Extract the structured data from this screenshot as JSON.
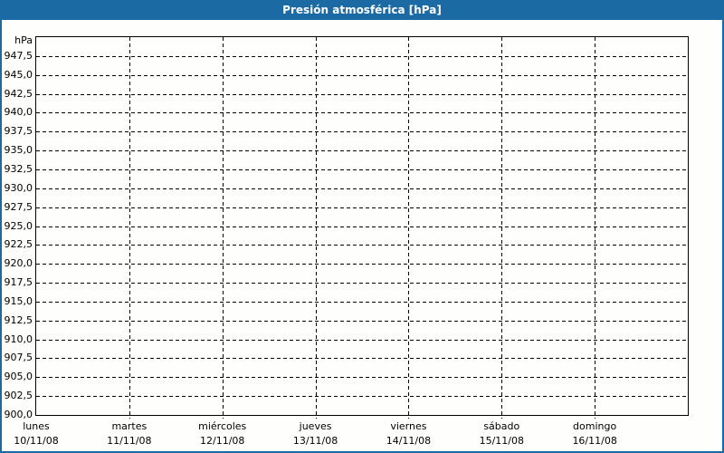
{
  "title_bar": {
    "title": "Presión atmosférica [hPa]"
  },
  "colors": {
    "title_bar_bg": "#1b6aa3",
    "frame_border": "#1b6aa3",
    "title_text": "#ffffff",
    "plot_bg": "#fefefc",
    "axis": "#000000",
    "grid": "#000000",
    "label_text": "#000000"
  },
  "chart_data": {
    "type": "line",
    "title": "Presión atmosférica [hPa]",
    "unit_label": "hPa",
    "grid": true,
    "y_axis": {
      "min": 900,
      "max": 950,
      "tick_step": 2.5,
      "decimal_separator": ",",
      "ticks": [
        {
          "value": 947.5,
          "label": "947,5"
        },
        {
          "value": 945.0,
          "label": "945,0"
        },
        {
          "value": 942.5,
          "label": "942,5"
        },
        {
          "value": 940.0,
          "label": "940,0"
        },
        {
          "value": 937.5,
          "label": "937,5"
        },
        {
          "value": 935.0,
          "label": "935,0"
        },
        {
          "value": 932.5,
          "label": "932,5"
        },
        {
          "value": 930.0,
          "label": "930,0"
        },
        {
          "value": 927.5,
          "label": "927,5"
        },
        {
          "value": 925.0,
          "label": "925,0"
        },
        {
          "value": 922.5,
          "label": "922,5"
        },
        {
          "value": 920.0,
          "label": "920,0"
        },
        {
          "value": 917.5,
          "label": "917,5"
        },
        {
          "value": 915.0,
          "label": "915,0"
        },
        {
          "value": 912.5,
          "label": "912,5"
        },
        {
          "value": 910.0,
          "label": "910,0"
        },
        {
          "value": 907.5,
          "label": "907,5"
        },
        {
          "value": 905.0,
          "label": "905,0"
        },
        {
          "value": 902.5,
          "label": "902,5"
        },
        {
          "value": 900.0,
          "label": "900,0"
        }
      ]
    },
    "x_axis": {
      "days": [
        {
          "name": "lunes",
          "date": "10/11/08"
        },
        {
          "name": "martes",
          "date": "11/11/08"
        },
        {
          "name": "miércoles",
          "date": "12/11/08"
        },
        {
          "name": "jueves",
          "date": "13/11/08"
        },
        {
          "name": "viernes",
          "date": "14/11/08"
        },
        {
          "name": "sábado",
          "date": "15/11/08"
        },
        {
          "name": "domingo",
          "date": "16/11/08"
        }
      ]
    },
    "series": []
  }
}
